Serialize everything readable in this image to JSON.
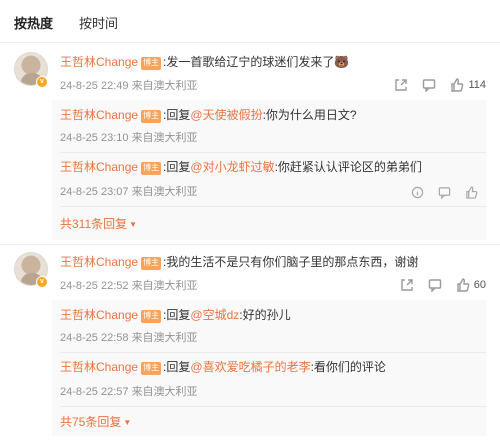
{
  "tabs": [
    {
      "label": "按热度",
      "active": true
    },
    {
      "label": "按时间",
      "active": false
    }
  ],
  "comments": [
    {
      "user": "王哲林Change",
      "badge": "博主",
      "text": ":发一首歌给辽宁的球迷们发来了",
      "emoji": "🐻",
      "time": "24-8-25 22:49",
      "location": "来自澳大利亚",
      "likes": "114",
      "replies": [
        {
          "user": "王哲林Change",
          "badge": "博主",
          "prefix": ":回复",
          "at": "@天使被假扮",
          "text": ":你为什么用日文?",
          "time": "24-8-25 23:10",
          "location": "来自澳大利亚"
        },
        {
          "user": "王哲林Change",
          "badge": "博主",
          "prefix": ":回复",
          "at": "@对小龙虾过敏",
          "text": ":你赶紧认认评论区的弟弟们",
          "time": "24-8-25 23:07",
          "location": "来自澳大利亚"
        }
      ],
      "more_label": "共311条回复"
    },
    {
      "user": "王哲林Change",
      "badge": "博主",
      "text": ":我的生活不是只有你们脑子里的那点东西，谢谢",
      "time": "24-8-25 22:52",
      "location": "来自澳大利亚",
      "likes": "60",
      "replies": [
        {
          "user": "王哲林Change",
          "badge": "博主",
          "prefix": ":回复",
          "at": "@空城dz",
          "text": ":好的孙儿",
          "time": "24-8-25 22:58",
          "location": "来自澳大利亚"
        },
        {
          "user": "王哲林Change",
          "badge": "博主",
          "prefix": ":回复",
          "at": "@喜欢爱吃橘子的老李",
          "text": ":看你们的评论",
          "time": "24-8-25 22:57",
          "location": "来自澳大利亚"
        }
      ],
      "more_label": "共75条回复"
    }
  ]
}
